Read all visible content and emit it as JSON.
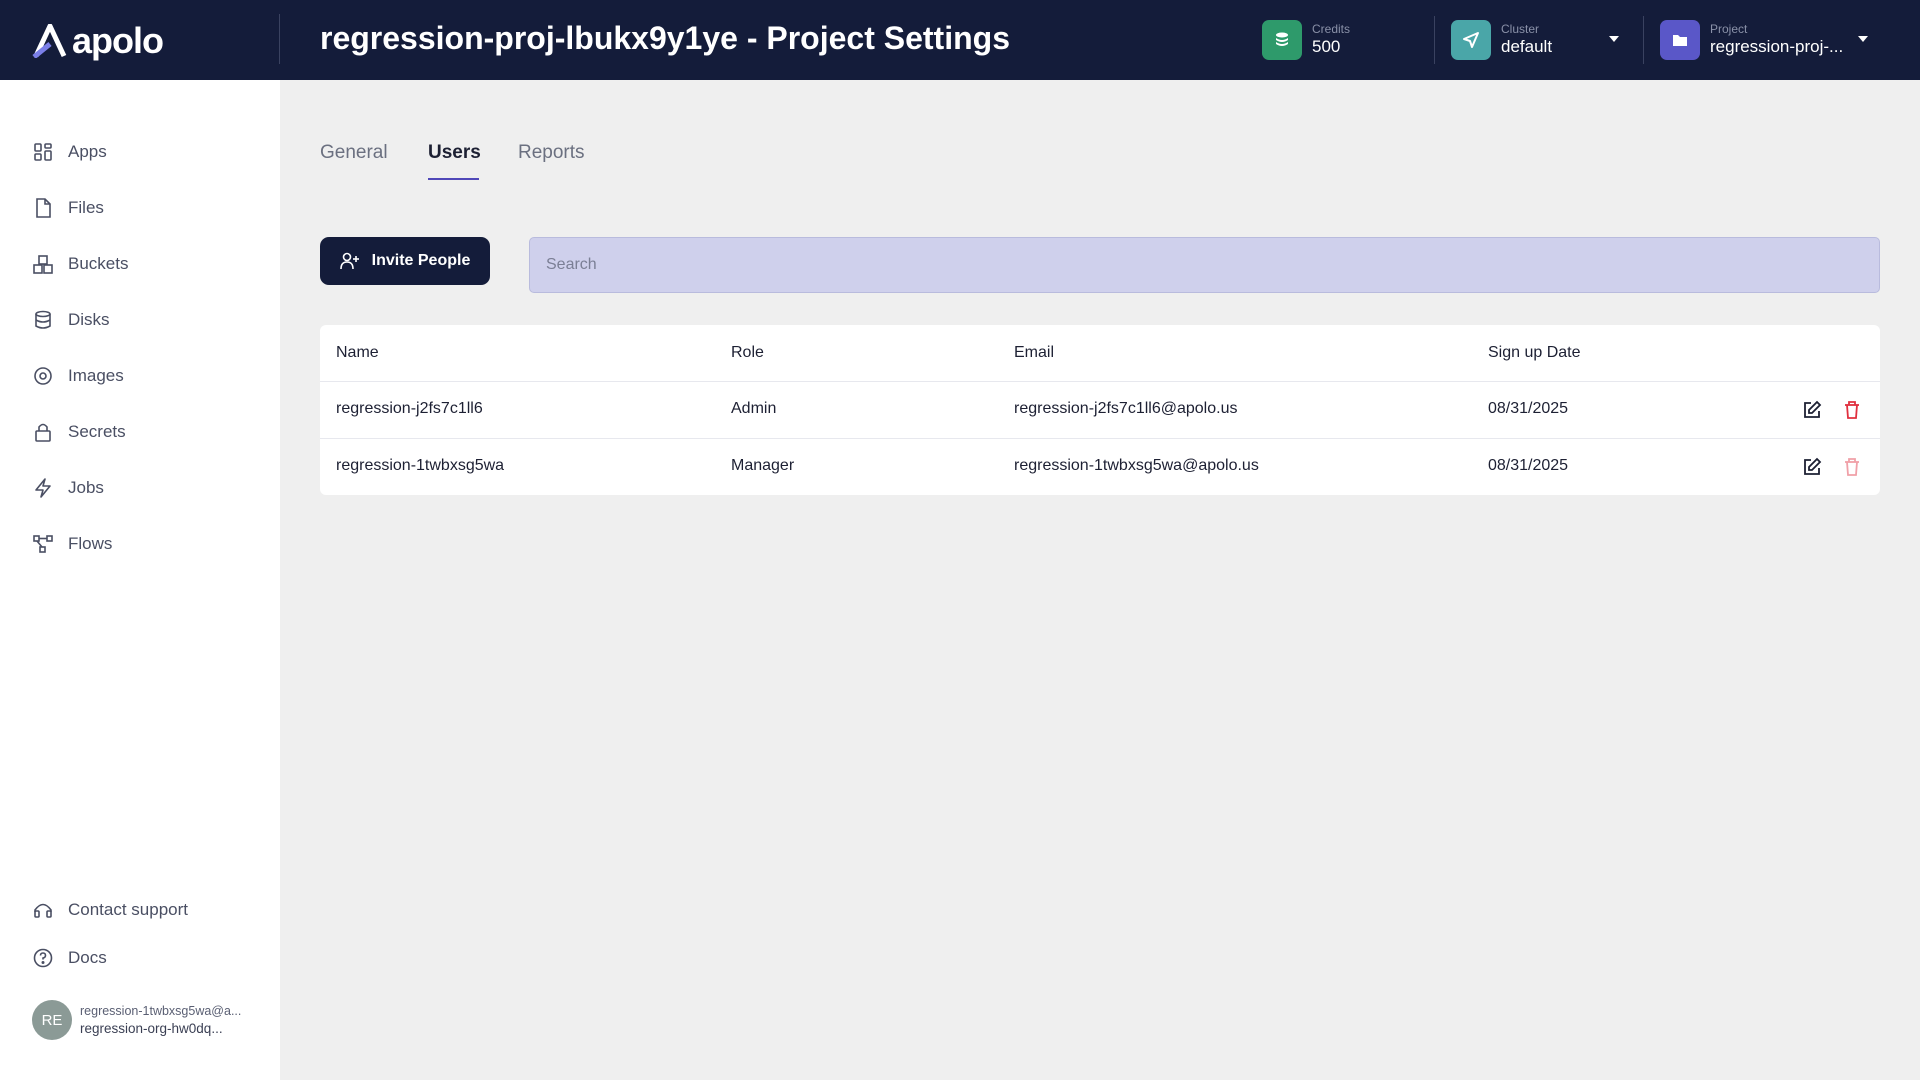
{
  "header": {
    "logo_text": "apolo",
    "page_title": "regression-proj-lbukx9y1ye - Project Settings",
    "credits": {
      "label": "Credits",
      "value": "500",
      "icon": "coins-icon",
      "color": "#2e9a6b"
    },
    "cluster": {
      "label": "Cluster",
      "value": "default",
      "icon": "send-icon",
      "color": "#4aa6a8"
    },
    "project": {
      "label": "Project",
      "value": "regression-proj-...",
      "icon": "folder-icon",
      "color": "#5a57c8"
    }
  },
  "sidebar": {
    "items": [
      {
        "label": "Apps",
        "icon": "apps-icon"
      },
      {
        "label": "Files",
        "icon": "file-icon"
      },
      {
        "label": "Buckets",
        "icon": "buckets-icon"
      },
      {
        "label": "Disks",
        "icon": "database-icon"
      },
      {
        "label": "Images",
        "icon": "disc-icon"
      },
      {
        "label": "Secrets",
        "icon": "lock-icon"
      },
      {
        "label": "Jobs",
        "icon": "lightning-icon"
      },
      {
        "label": "Flows",
        "icon": "flow-icon"
      }
    ],
    "footer": [
      {
        "label": "Contact support",
        "icon": "headset-icon"
      },
      {
        "label": "Docs",
        "icon": "help-circle-icon"
      }
    ],
    "user": {
      "initials": "RE",
      "email": "regression-1twbxsg5wa@a...",
      "org": "regression-org-hw0dq..."
    }
  },
  "tabs": [
    {
      "label": "General",
      "active": false
    },
    {
      "label": "Users",
      "active": true
    },
    {
      "label": "Reports",
      "active": false
    }
  ],
  "toolbar": {
    "invite_label": "Invite People",
    "search_placeholder": "Search",
    "search_value": ""
  },
  "table": {
    "columns": [
      "Name",
      "Role",
      "Email",
      "Sign up Date"
    ],
    "rows": [
      {
        "name": "regression-j2fs7c1ll6",
        "role": "Admin",
        "email": "regression-j2fs7c1ll6@apolo.us",
        "date": "08/31/2025",
        "delete_enabled": true
      },
      {
        "name": "regression-1twbxsg5wa",
        "role": "Manager",
        "email": "regression-1twbxsg5wa@apolo.us",
        "date": "08/31/2025",
        "delete_enabled": false
      }
    ]
  },
  "colors": {
    "header_bg": "#141c3a",
    "accent": "#5048b8",
    "danger": "#e0303f",
    "danger_disabled": "#f0a0a8"
  }
}
